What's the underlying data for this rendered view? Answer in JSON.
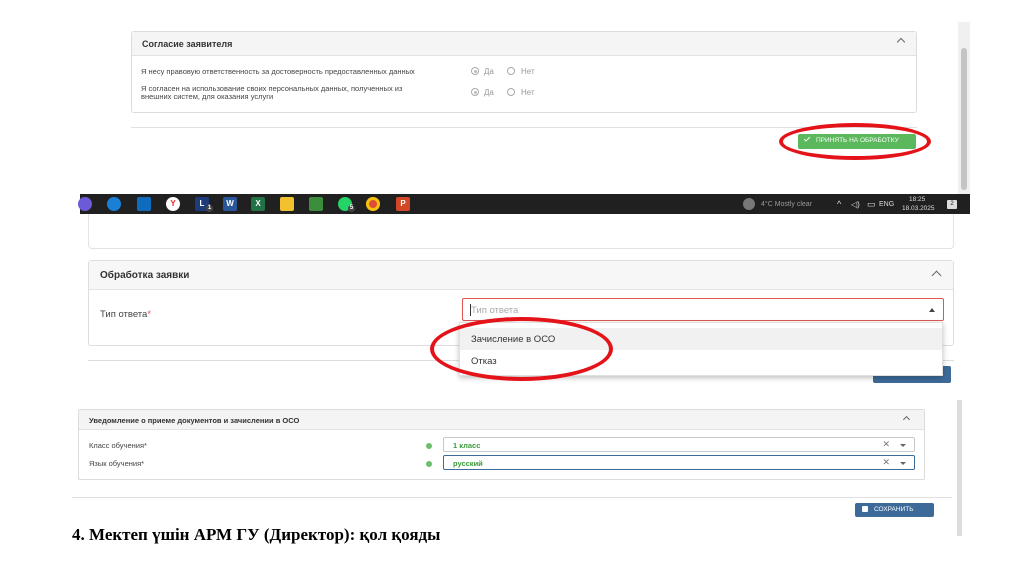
{
  "consent": {
    "title": "Согласие заявителя",
    "q1": "Я несу правовую ответственность за достоверность предоставленных данных",
    "q2_line1": "Я согласен на использование своих персональных данных, полученных из",
    "q2_line2": "внешних систем, для оказания услуги",
    "yes": "Да",
    "no": "Нет",
    "q1_selected": "Да",
    "q2_selected": "Да",
    "accept_label": "ПРИНЯТЬ НА ОБРАБОТКУ"
  },
  "taskbar": {
    "weather": "4°C  Mostly clear",
    "lang": "ENG",
    "time": "18:25",
    "date": "18.03.2025",
    "notifications": "2",
    "apps": [
      "L",
      "W",
      "X",
      "P"
    ],
    "app_badges": [
      "1",
      "5"
    ]
  },
  "processing": {
    "title": "Обработка заявки",
    "type_label": "Тип ответа",
    "required_mark": "*",
    "type_placeholder": "Тип ответа",
    "options": [
      "Зачисление в ОСО",
      "Отказ"
    ]
  },
  "notification": {
    "title": "Уведомление о приеме документов и зачислении в ОСО",
    "class_label": "Класс обучения",
    "class_value": "1 класс",
    "lang_label": "Язык обучения",
    "lang_value": "русский",
    "required_mark": "*",
    "clear_glyph": "✕",
    "save_label": "СОХРАНИТЬ"
  },
  "caption": "4. Мектеп үшін АРМ ГУ (Директор): қол қояды",
  "colors": {
    "accent_green": "#5cb85c",
    "accent_blue": "#3d6b99",
    "highlight_red": "#e4131a"
  }
}
